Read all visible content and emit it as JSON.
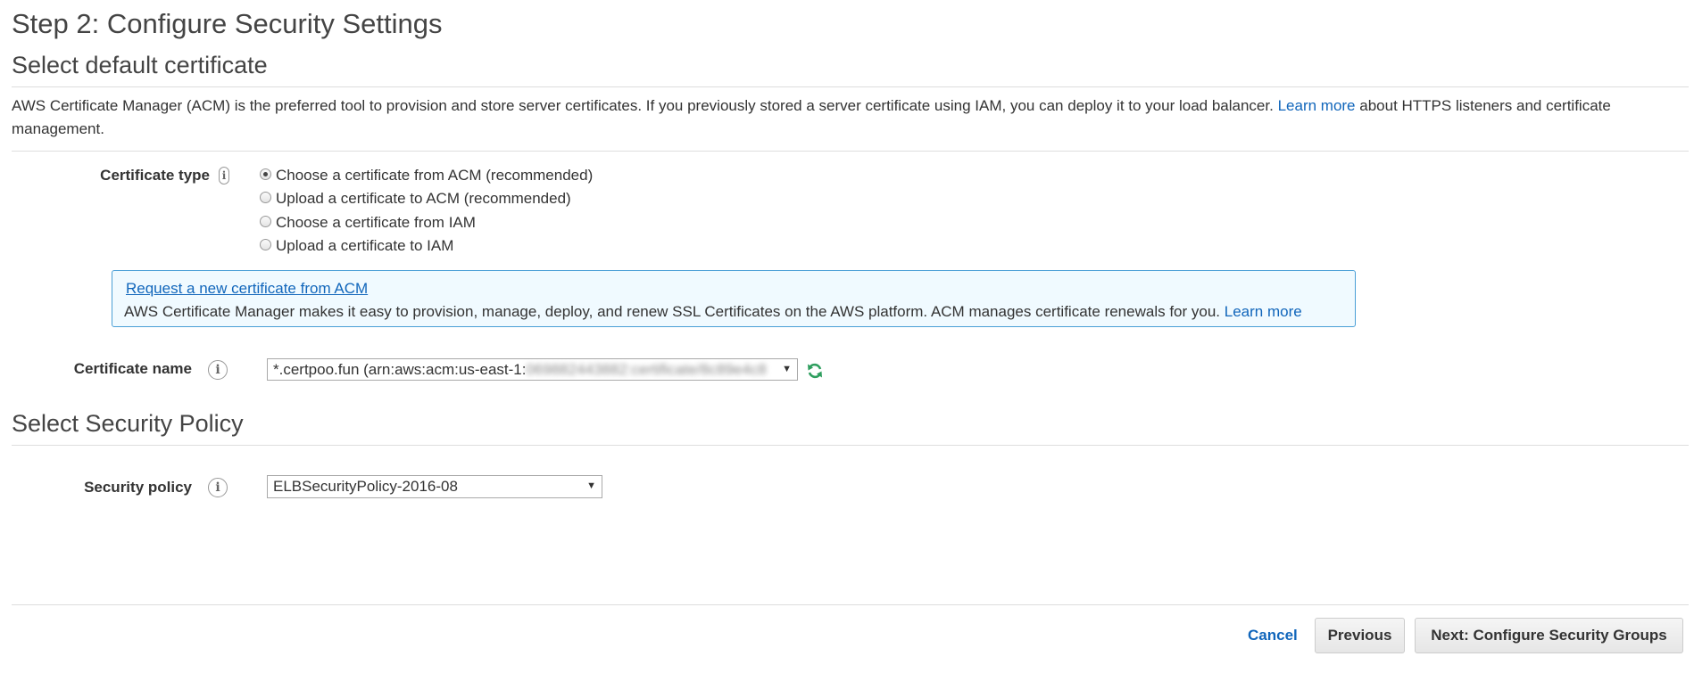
{
  "page": {
    "title": "Step 2: Configure Security Settings"
  },
  "certificate_section": {
    "heading": "Select default certificate",
    "description_text": "AWS Certificate Manager (ACM) is the preferred tool to provision and store server certificates. If you previously stored a server certificate using IAM, you can deploy it to your load balancer.",
    "description_link": "Learn more",
    "description_suffix": "about HTTPS listeners and certificate management.",
    "type_label": "Certificate type",
    "options": [
      {
        "label": "Choose a certificate from ACM (recommended)",
        "checked": true
      },
      {
        "label": "Upload a certificate to ACM (recommended)",
        "checked": false
      },
      {
        "label": "Choose a certificate from IAM",
        "checked": false
      },
      {
        "label": "Upload a certificate to IAM",
        "checked": false
      }
    ],
    "infobox": {
      "title": "Request a new certificate from ACM",
      "text": "AWS Certificate Manager makes it easy to provision, manage, deploy, and renew SSL Certificates on the AWS platform. ACM manages certificate renewals for you.",
      "link": "Learn more"
    },
    "name_label": "Certificate name",
    "name_value": "*.certpoo.fun (arn:aws:acm:us-east-1:",
    "name_value_redacted": "069882443882:certificate/8c89e4c8"
  },
  "policy_section": {
    "heading": "Select Security Policy",
    "label": "Security policy",
    "value": "ELBSecurityPolicy-2016-08"
  },
  "footer": {
    "cancel": "Cancel",
    "previous": "Previous",
    "next": "Next: Configure Security Groups"
  },
  "colors": {
    "link": "#1166bb",
    "infobox_border": "#4a9fd6",
    "infobox_bg": "#f0faff",
    "refresh_icon": "#2e9e5e"
  },
  "icons": [
    "info-icon",
    "refresh-icon",
    "chevron-down-icon"
  ]
}
